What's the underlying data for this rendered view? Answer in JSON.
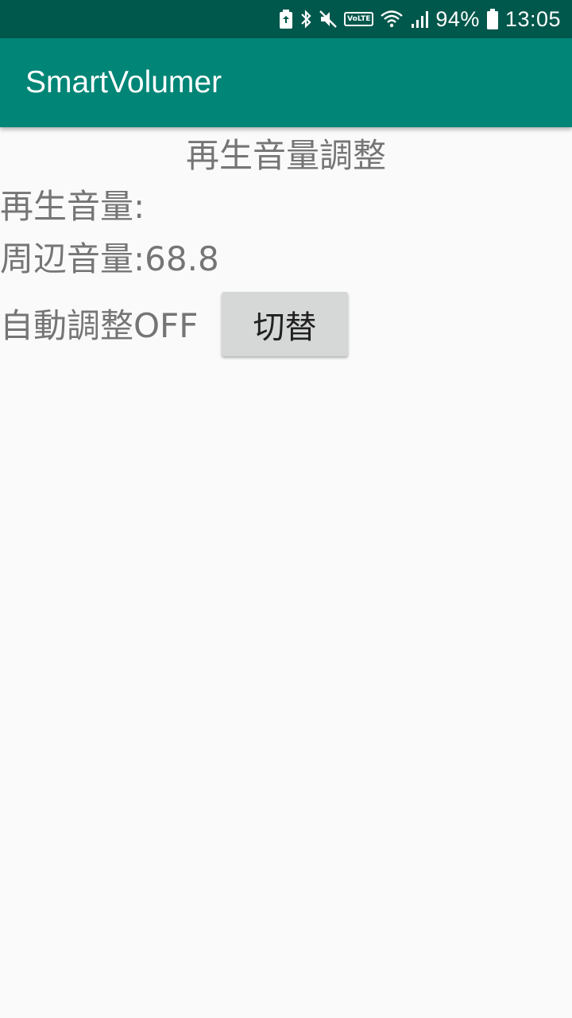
{
  "status_bar": {
    "battery_percent": "94%",
    "time": "13:05",
    "volte_label": "VoLTE",
    "icons": [
      "battery-saver-icon",
      "bluetooth-icon",
      "mute-icon",
      "volte-icon",
      "wifi-icon",
      "signal-icon",
      "battery-icon"
    ],
    "background_color": "#00574b"
  },
  "app_bar": {
    "title": "SmartVolumer",
    "background_color": "#008577"
  },
  "main": {
    "heading": "再生音量調整",
    "playback_volume_label": "再生音量:",
    "ambient_volume_label": "周辺音量:68.8",
    "auto_adjust_label": "自動調整OFF",
    "toggle_button_label": "切替"
  }
}
